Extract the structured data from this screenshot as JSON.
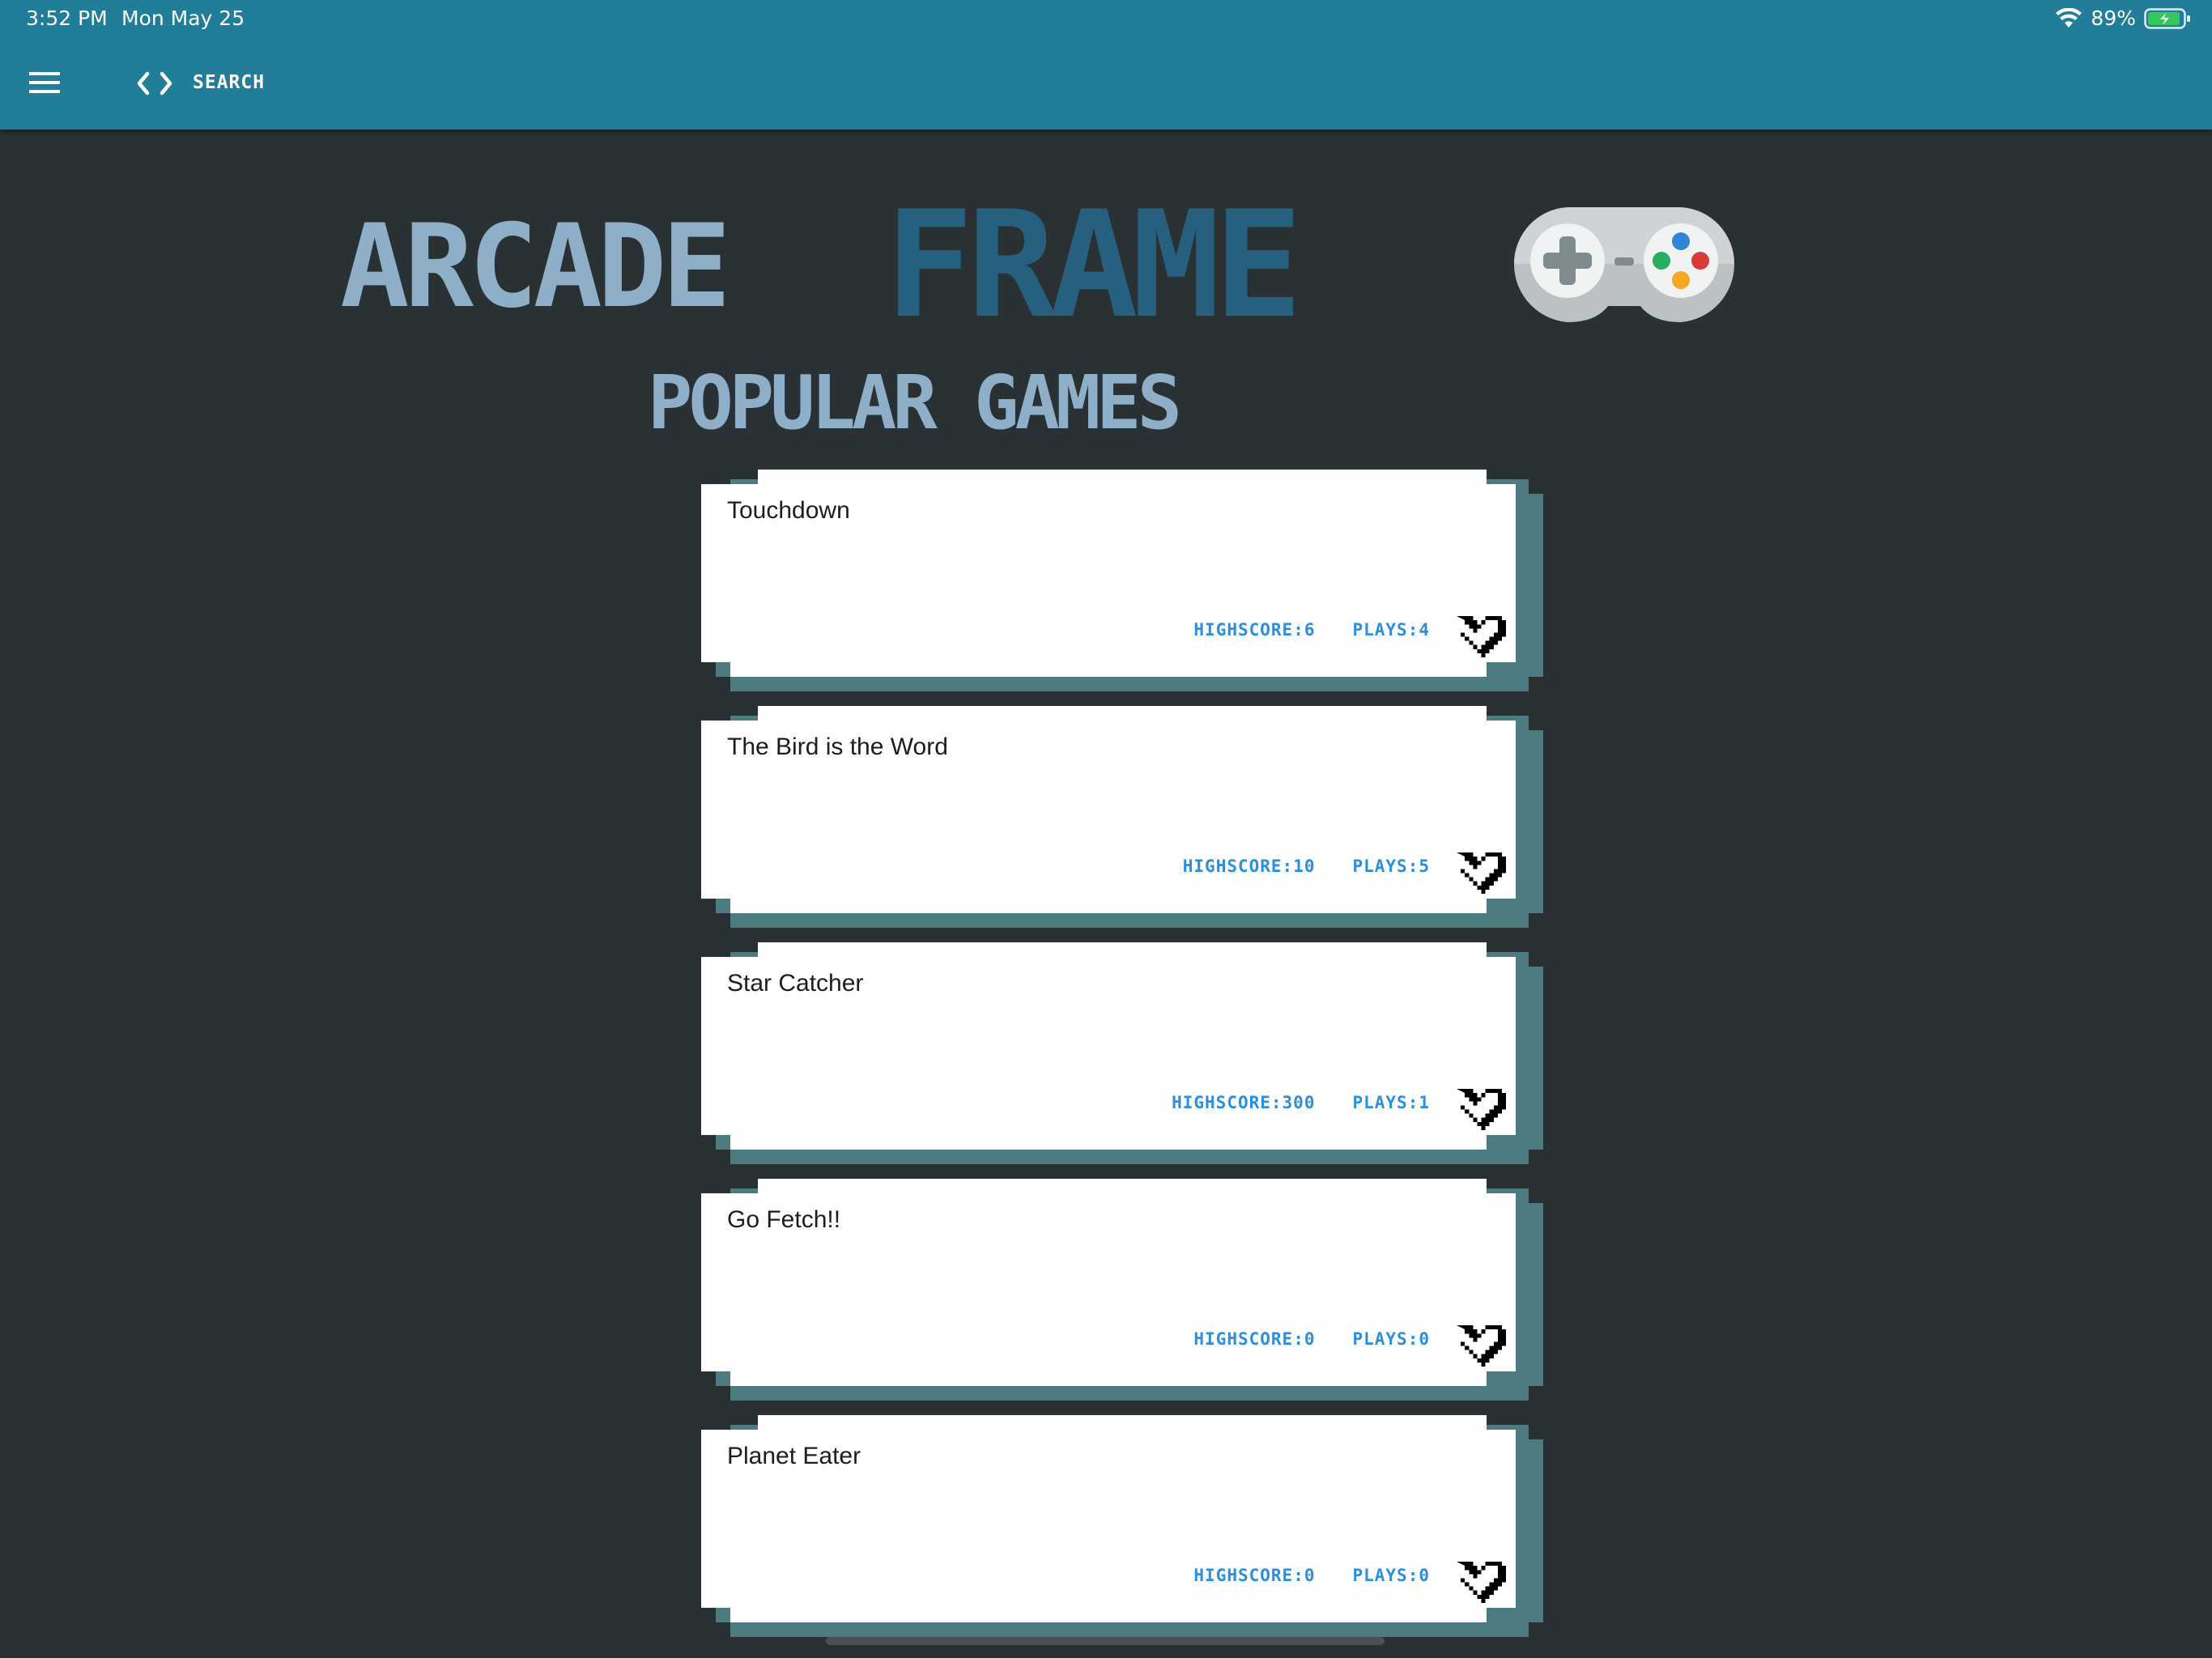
{
  "status_bar": {
    "time": "3:52 PM",
    "date": "Mon May 25",
    "battery": "89%",
    "icons": [
      "wifi-icon",
      "battery-icon"
    ]
  },
  "toolbar": {
    "search_label": "SEARCH",
    "icons": [
      "menu-icon",
      "code-icon"
    ]
  },
  "logo": {
    "arcade": "ARCADE",
    "frame": "FRAME",
    "icon": "gamepad-icon"
  },
  "heading": "POPULAR GAMES",
  "colors": {
    "topbar": "#227d99",
    "background": "#293135",
    "logo_light": "#8fafc8",
    "logo_dark": "#27607f",
    "stats": "#2a8fdc",
    "card_shadow": "#4d7c80"
  },
  "games": [
    {
      "title": "Touchdown",
      "highscore": "HIGHSCORE:6",
      "plays": "PLAYS:4"
    },
    {
      "title": "The Bird is the Word",
      "highscore": "HIGHSCORE:10",
      "plays": "PLAYS:5"
    },
    {
      "title": "Star Catcher",
      "highscore": "HIGHSCORE:300",
      "plays": "PLAYS:1"
    },
    {
      "title": "Go Fetch!!",
      "highscore": "HIGHSCORE:0",
      "plays": "PLAYS:0"
    },
    {
      "title": "Planet Eater",
      "highscore": "HIGHSCORE:0",
      "plays": "PLAYS:0"
    }
  ]
}
